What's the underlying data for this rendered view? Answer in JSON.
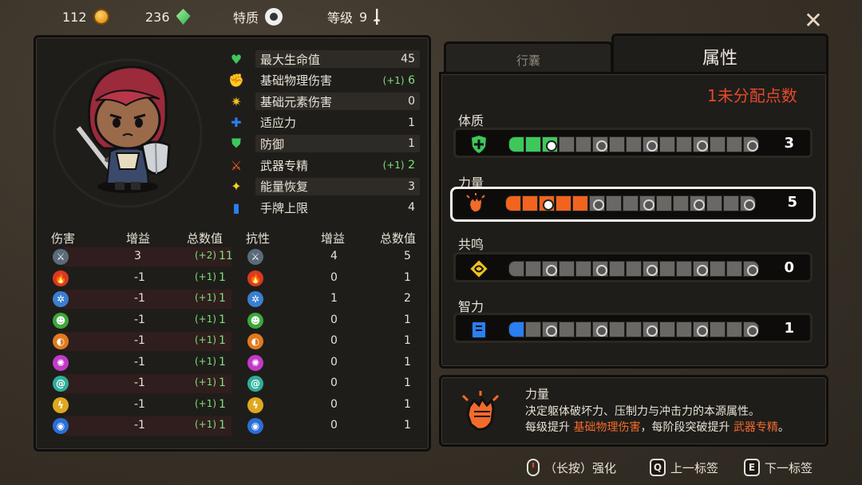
{
  "topbar": {
    "gold": "112",
    "gems": "236",
    "traits_label": "特质",
    "level_label": "等级",
    "level_value": "9"
  },
  "stats": [
    {
      "icon": "heart-icon",
      "label": "最大生命值",
      "value": "45",
      "bonus": ""
    },
    {
      "icon": "fist-icon",
      "label": "基础物理伤害",
      "value": "6",
      "bonus": "(+1)"
    },
    {
      "icon": "element-burst-icon",
      "label": "基础元素伤害",
      "value": "0",
      "bonus": ""
    },
    {
      "icon": "puzzle-icon",
      "label": "适应力",
      "value": "1",
      "bonus": ""
    },
    {
      "icon": "shield-icon",
      "label": "防御",
      "value": "1",
      "bonus": ""
    },
    {
      "icon": "weapon-mastery-icon",
      "label": "武器专精",
      "value": "2",
      "bonus": "(+1)"
    },
    {
      "icon": "sparkle-icon",
      "label": "能量恢复",
      "value": "3",
      "bonus": ""
    },
    {
      "icon": "cards-icon",
      "label": "手牌上限",
      "value": "4",
      "bonus": ""
    }
  ],
  "damage_table": {
    "headers": [
      "伤害",
      "增益",
      "总数值",
      "抗性",
      "增益",
      "总数值"
    ],
    "rows": [
      {
        "element": "physical",
        "color": "#5a6b7a",
        "dmg_gain": "3",
        "dmg_total_bonus": "(+2)",
        "dmg_total": "11",
        "res_gain": "4",
        "res_total": "5"
      },
      {
        "element": "fire",
        "color": "#d93a1f",
        "dmg_gain": "-1",
        "dmg_total_bonus": "(+1)",
        "dmg_total": "1",
        "res_gain": "0",
        "res_total": "1"
      },
      {
        "element": "ice",
        "color": "#3a7fd0",
        "dmg_gain": "-1",
        "dmg_total_bonus": "(+1)",
        "dmg_total": "1",
        "res_gain": "1",
        "res_total": "2"
      },
      {
        "element": "poison",
        "color": "#3da83a",
        "dmg_gain": "-1",
        "dmg_total_bonus": "(+1)",
        "dmg_total": "1",
        "res_gain": "0",
        "res_total": "1"
      },
      {
        "element": "earth",
        "color": "#e07a1f",
        "dmg_gain": "-1",
        "dmg_total_bonus": "(+1)",
        "dmg_total": "1",
        "res_gain": "0",
        "res_total": "1"
      },
      {
        "element": "arcane",
        "color": "#c13ac8",
        "dmg_gain": "-1",
        "dmg_total_bonus": "(+1)",
        "dmg_total": "1",
        "res_gain": "0",
        "res_total": "1"
      },
      {
        "element": "wind",
        "color": "#2fae9a",
        "dmg_gain": "-1",
        "dmg_total_bonus": "(+1)",
        "dmg_total": "1",
        "res_gain": "0",
        "res_total": "1"
      },
      {
        "element": "lightning",
        "color": "#e0a81f",
        "dmg_gain": "-1",
        "dmg_total_bonus": "(+1)",
        "dmg_total": "1",
        "res_gain": "0",
        "res_total": "1"
      },
      {
        "element": "water",
        "color": "#2a6fd8",
        "dmg_gain": "-1",
        "dmg_total_bonus": "(+1)",
        "dmg_total": "1",
        "res_gain": "0",
        "res_total": "1"
      }
    ]
  },
  "tabs": {
    "bag": "行囊",
    "attributes": "属性"
  },
  "unassigned": {
    "count": "1",
    "label": "未分配点数"
  },
  "attributes": [
    {
      "name": "体质",
      "value": "3",
      "color": "#3ec85a",
      "filled": 3,
      "icon": "constitution-icon"
    },
    {
      "name": "力量",
      "value": "5",
      "color": "#f2641e",
      "filled": 5,
      "icon": "strength-fist-icon"
    },
    {
      "name": "共鸣",
      "value": "0",
      "color": "#f2c21e",
      "filled": 0,
      "icon": "resonance-icon"
    },
    {
      "name": "智力",
      "value": "1",
      "color": "#2a7ff2",
      "filled": 1,
      "icon": "intellect-book-icon"
    }
  ],
  "description": {
    "title": "力量",
    "line1": "决定躯体破坏力、压制力与冲击力的本源属性。",
    "line2_a": "每级提升 ",
    "line2_hl1": "基础物理伤害",
    "line2_b": "，每阶段突破提升 ",
    "line2_hl2": "武器专精",
    "line2_c": "。"
  },
  "hints": {
    "strengthen": "（长按）强化",
    "prev": "上一标签",
    "next": "下一标签",
    "key_prev": "Q",
    "key_next": "E"
  },
  "colors": {
    "accent_orange": "#f26b2a",
    "bonus_green": "#7fe07a",
    "unassigned_red": "#e24a2a"
  }
}
